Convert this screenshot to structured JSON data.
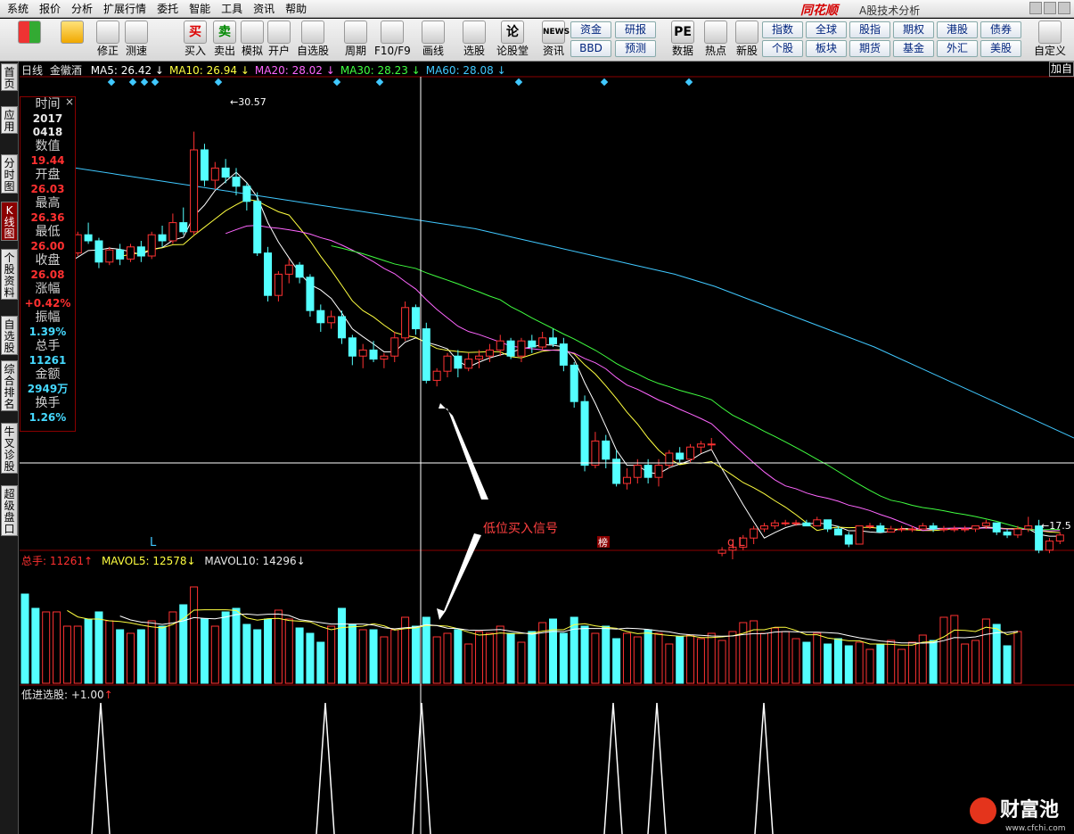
{
  "menu": [
    "系统",
    "报价",
    "分析",
    "扩展行情",
    "委托",
    "智能",
    "工具",
    "资讯",
    "帮助"
  ],
  "brand": {
    "logo": "同花顺",
    "subtitle": "A股技术分析"
  },
  "toolbar": {
    "buttons": [
      {
        "label": "",
        "icon": "color-grid-icon"
      },
      {
        "label": "",
        "icon": "back-arrow-icon"
      },
      {
        "label": "修正",
        "icon": "up-arrow-icon"
      },
      {
        "label": "测速",
        "icon": "clock-icon"
      },
      {
        "label": "买入",
        "icon": "buy-icon",
        "glyph": "买"
      },
      {
        "label": "卖出",
        "icon": "sell-icon",
        "glyph": "卖"
      },
      {
        "label": "模拟",
        "icon": "hammer-icon"
      },
      {
        "label": "开户",
        "icon": "lock-icon"
      },
      {
        "label": "自选股",
        "icon": "star-icon"
      },
      {
        "label": "周期",
        "icon": "cycle-icon"
      },
      {
        "label": "F10/F9",
        "icon": "f10-icon"
      },
      {
        "label": "画线",
        "icon": "pen-icon"
      },
      {
        "label": "选股",
        "icon": "stock-pick-icon"
      },
      {
        "label": "论股堂",
        "icon": "forum-icon",
        "glyph": "论"
      },
      {
        "label": "资讯",
        "icon": "news-icon",
        "glyph": "NEWS"
      },
      {
        "label": "数据",
        "icon": "pe-icon",
        "glyph": "PE"
      },
      {
        "label": "热点",
        "icon": "hot-icon"
      },
      {
        "label": "新股",
        "icon": "new-stock-icon"
      },
      {
        "label": "自定义",
        "icon": "custom-icon"
      }
    ],
    "grid": [
      "资金",
      "研报",
      "BBD",
      "预测",
      "指数",
      "全球",
      "股指",
      "期权",
      "港股",
      "债券",
      "个股",
      "板块",
      "期货",
      "基金",
      "外汇",
      "美股"
    ]
  },
  "left_tabs": [
    "首页",
    "应用",
    "分时图",
    "K线图",
    "个股资料",
    "自选股",
    "综合排名",
    "牛叉诊股",
    "超级盘口"
  ],
  "chart_header": {
    "period": "日线",
    "name": "金徽酒",
    "ma": [
      {
        "label": "MA5: 26.42",
        "arrow": "↓",
        "color": "#ffffff"
      },
      {
        "label": "MA10: 26.94",
        "arrow": "↓",
        "color": "#ffff40"
      },
      {
        "label": "MA20: 28.02",
        "arrow": "↓",
        "color": "#ff66ff"
      },
      {
        "label": "MA30: 28.23",
        "arrow": "↓",
        "color": "#40ff40"
      },
      {
        "label": "MA60: 28.08",
        "arrow": "↓",
        "color": "#40c8ff"
      }
    ],
    "add_btn": "加自"
  },
  "info": {
    "time_label": "时间",
    "time_year": "2017",
    "time_date": "0418",
    "value_label": "数值",
    "value": "19.44",
    "open_label": "开盘",
    "open": "26.03",
    "high_label": "最高",
    "high": "26.36",
    "low_label": "最低",
    "low": "26.00",
    "close_label": "收盘",
    "close": "26.08",
    "chg_label": "涨幅",
    "chg": "+0.42%",
    "amp_label": "振幅",
    "amp": "1.39%",
    "vol_label": "总手",
    "vol": "11261",
    "amt_label": "金额",
    "amt": "2949万",
    "turn_label": "换手",
    "turn": "1.26%"
  },
  "annotations": {
    "high_label": "30.57",
    "low_label": "17.5",
    "signal_text": "低位买入信号",
    "marker_L1": "L",
    "marker_bang": "榜",
    "marker_qL": "q L"
  },
  "volume_header": {
    "vol": "总手: 11261",
    "mavol5": "MAVOL5: 12578",
    "mavol10": "MAVOL10: 14296"
  },
  "indicator_header": {
    "label": "低进选股: +1.00"
  },
  "watermark": {
    "text": "财富池",
    "url": "www.cfchi.com"
  },
  "colors": {
    "up": "#ff3232",
    "down": "#54ffff",
    "ma5": "#ffffff",
    "ma10": "#ffff40",
    "ma20": "#ff66ff",
    "ma30": "#40ff40",
    "ma60": "#40c8ff"
  },
  "chart_data": {
    "type": "candlestick",
    "price_ylim": [
      17,
      32
    ],
    "candles": [
      [
        26.3,
        26.5,
        26.0,
        26.2
      ],
      [
        26.2,
        26.4,
        25.7,
        25.9
      ],
      [
        25.9,
        26.3,
        25.7,
        26.2
      ],
      [
        26.2,
        26.6,
        26.0,
        26.4
      ],
      [
        26.4,
        26.8,
        26.2,
        26.6
      ],
      [
        26.6,
        27.3,
        26.5,
        27.2
      ],
      [
        27.2,
        27.6,
        26.9,
        27.0
      ],
      [
        27.0,
        27.1,
        26.1,
        26.3
      ],
      [
        26.3,
        26.8,
        26.2,
        26.7
      ],
      [
        26.7,
        26.9,
        26.2,
        26.4
      ],
      [
        26.4,
        26.9,
        26.3,
        26.8
      ],
      [
        26.8,
        27.0,
        26.3,
        26.5
      ],
      [
        26.5,
        27.3,
        26.4,
        27.2
      ],
      [
        27.2,
        27.5,
        26.8,
        27.0
      ],
      [
        27.0,
        27.9,
        26.9,
        27.6
      ],
      [
        27.6,
        28.1,
        27.2,
        27.3
      ],
      [
        27.3,
        30.6,
        27.2,
        30.0
      ],
      [
        30.0,
        30.2,
        28.8,
        29.0
      ],
      [
        29.0,
        29.6,
        28.7,
        29.4
      ],
      [
        29.4,
        29.7,
        28.9,
        29.1
      ],
      [
        29.1,
        29.4,
        28.5,
        28.8
      ],
      [
        28.8,
        28.9,
        28.0,
        28.3
      ],
      [
        28.3,
        28.6,
        26.5,
        26.6
      ],
      [
        26.6,
        26.8,
        25.0,
        25.2
      ],
      [
        25.2,
        26.0,
        25.0,
        25.9
      ],
      [
        25.9,
        26.4,
        25.6,
        26.2
      ],
      [
        26.2,
        26.3,
        25.6,
        25.8
      ],
      [
        25.8,
        25.9,
        24.5,
        24.7
      ],
      [
        24.7,
        24.9,
        24.0,
        24.3
      ],
      [
        24.3,
        24.7,
        24.1,
        24.5
      ],
      [
        24.5,
        24.7,
        23.6,
        23.8
      ],
      [
        23.8,
        23.9,
        22.9,
        23.2
      ],
      [
        23.2,
        23.6,
        22.8,
        23.4
      ],
      [
        23.4,
        23.7,
        23.0,
        23.1
      ],
      [
        23.1,
        23.3,
        22.8,
        23.2
      ],
      [
        23.2,
        24.0,
        23.0,
        23.8
      ],
      [
        23.8,
        25.0,
        23.7,
        24.8
      ],
      [
        24.8,
        24.9,
        23.9,
        24.1
      ],
      [
        24.1,
        24.3,
        22.3,
        22.4
      ],
      [
        22.4,
        22.8,
        22.2,
        22.7
      ],
      [
        22.7,
        23.3,
        22.5,
        23.2
      ],
      [
        23.2,
        23.4,
        22.5,
        22.8
      ],
      [
        22.8,
        23.3,
        22.7,
        23.1
      ],
      [
        23.1,
        23.4,
        22.8,
        23.2
      ],
      [
        23.2,
        23.6,
        23.0,
        23.4
      ],
      [
        23.4,
        23.9,
        23.2,
        23.7
      ],
      [
        23.7,
        23.8,
        23.1,
        23.2
      ],
      [
        23.2,
        23.8,
        23.0,
        23.7
      ],
      [
        23.7,
        23.9,
        23.3,
        23.5
      ],
      [
        23.5,
        24.0,
        23.4,
        23.8
      ],
      [
        23.8,
        24.1,
        23.5,
        23.6
      ],
      [
        23.6,
        23.8,
        22.7,
        22.9
      ],
      [
        22.9,
        23.0,
        21.5,
        21.7
      ],
      [
        21.7,
        21.9,
        19.4,
        19.6
      ],
      [
        19.6,
        20.7,
        19.5,
        20.4
      ],
      [
        20.4,
        20.6,
        19.5,
        19.8
      ],
      [
        19.8,
        20.1,
        18.9,
        19.0
      ],
      [
        19.0,
        19.5,
        18.8,
        19.2
      ],
      [
        19.2,
        19.8,
        19.0,
        19.6
      ],
      [
        19.6,
        19.8,
        19.0,
        19.2
      ],
      [
        19.2,
        19.8,
        18.9,
        19.6
      ],
      [
        19.6,
        20.1,
        19.5,
        20.0
      ],
      [
        20.0,
        20.2,
        19.7,
        19.8
      ],
      [
        19.8,
        20.3,
        19.7,
        20.2
      ],
      [
        20.2,
        20.4,
        20.0,
        20.3
      ],
      [
        20.3,
        20.5,
        20.1,
        20.3
      ],
      [
        16.7,
        16.9,
        16.6,
        16.8
      ],
      [
        16.8,
        17.0,
        16.5,
        16.9
      ],
      [
        16.9,
        17.3,
        16.8,
        17.2
      ],
      [
        17.2,
        17.6,
        17.0,
        17.5
      ],
      [
        17.5,
        17.7,
        17.4,
        17.6
      ],
      [
        17.6,
        17.8,
        17.5,
        17.7
      ],
      [
        17.7,
        17.8,
        17.6,
        17.7
      ],
      [
        17.7,
        17.8,
        17.6,
        17.7
      ],
      [
        17.7,
        17.8,
        17.6,
        17.6
      ],
      [
        17.6,
        17.9,
        17.6,
        17.8
      ],
      [
        17.8,
        17.8,
        17.4,
        17.5
      ],
      [
        17.5,
        17.6,
        17.3,
        17.3
      ],
      [
        17.3,
        17.4,
        16.9,
        17.0
      ],
      [
        17.0,
        17.6,
        17.0,
        17.6
      ],
      [
        17.6,
        17.7,
        17.5,
        17.6
      ],
      [
        17.6,
        17.7,
        17.4,
        17.4
      ],
      [
        17.4,
        17.6,
        17.4,
        17.5
      ],
      [
        17.5,
        17.6,
        17.4,
        17.5
      ],
      [
        17.5,
        17.6,
        17.4,
        17.5
      ],
      [
        17.5,
        17.7,
        17.5,
        17.6
      ],
      [
        17.6,
        17.7,
        17.4,
        17.5
      ],
      [
        17.5,
        17.6,
        17.4,
        17.5
      ],
      [
        17.5,
        17.6,
        17.4,
        17.5
      ],
      [
        17.5,
        17.6,
        17.4,
        17.5
      ],
      [
        17.5,
        17.6,
        17.4,
        17.6
      ],
      [
        17.6,
        17.8,
        17.5,
        17.7
      ],
      [
        17.7,
        17.7,
        17.3,
        17.4
      ],
      [
        17.4,
        17.5,
        17.2,
        17.3
      ],
      [
        17.3,
        17.6,
        17.2,
        17.5
      ],
      [
        17.5,
        17.9,
        17.4,
        17.6
      ],
      [
        17.6,
        17.8,
        16.7,
        16.8
      ],
      [
        16.8,
        17.2,
        16.7,
        17.1
      ],
      [
        17.1,
        17.4,
        17.0,
        17.3
      ]
    ],
    "ma60": [
      29.4,
      29.2,
      29.0,
      28.8,
      28.6,
      28.4,
      28.2,
      28.0,
      27.8,
      27.6,
      27.4,
      27.1,
      26.8,
      26.5,
      26.2,
      25.9,
      25.5,
      25.0,
      24.5,
      24.0,
      23.5,
      22.9,
      22.3,
      21.7,
      21.1,
      20.5
    ],
    "volumes": [
      5,
      4.2,
      4,
      4,
      3.2,
      3.2,
      3.6,
      4,
      3.5,
      3,
      2.8,
      3,
      3.5,
      3.2,
      4,
      4.4,
      5.4,
      3.6,
      3.2,
      4,
      4.2,
      3.3,
      3,
      3.6,
      4.1,
      3.6,
      3.1,
      2.8,
      2.3,
      3.2,
      4.2,
      3.3,
      3,
      3,
      2.6,
      3,
      3.7,
      3.2,
      3.7,
      2.6,
      2.8,
      3,
      2.2,
      2.9,
      2.8,
      3.2,
      2.8,
      2.3,
      2.9,
      3.4,
      3.6,
      2.8,
      3.7,
      3.2,
      2.8,
      3.2,
      2.5,
      2.8,
      2.6,
      3,
      2.8,
      2.2,
      2.6,
      2.7,
      2.5,
      2.8,
      2.4,
      2.9,
      3.4,
      3.5,
      2.8,
      3.1,
      2.9,
      2.5,
      2.3,
      2.8,
      2.2,
      2.5,
      2.1,
      2.3,
      1.9,
      2.2,
      2.4,
      1.9,
      2.3,
      2.7,
      2.4,
      3.7,
      3.8,
      2.2,
      2.4,
      3.6,
      3.3,
      2.1,
      2.9
    ],
    "signals": [
      113,
      365,
      473,
      688,
      737,
      857
    ]
  }
}
